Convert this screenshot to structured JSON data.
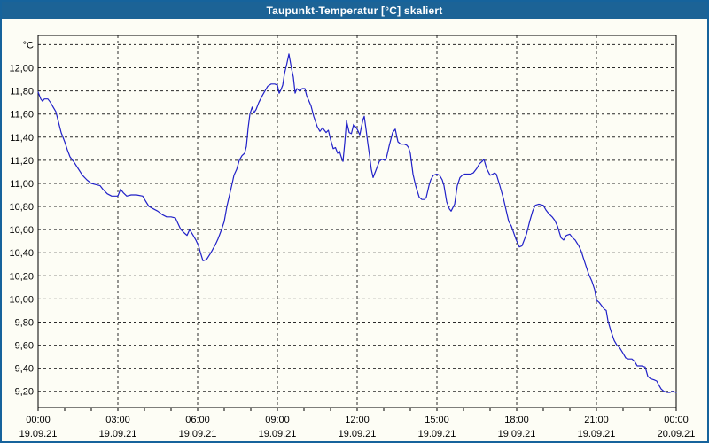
{
  "window": {
    "title": "Taupunkt-Temperatur [°C] skaliert"
  },
  "colors": {
    "titlebar_bg": "#1c6396",
    "titlebar_text": "#ffffff",
    "window_border": "#16639c",
    "window_bg": "#fdfdf5",
    "grid": "#2a2a2a",
    "axis": "#000000",
    "line": "#2121c8"
  },
  "chart_data": {
    "type": "line",
    "title": "Taupunkt-Temperatur [°C] skaliert",
    "ylabel_unit": "°C",
    "x_unit": "minutes since 00:00 19.09.21",
    "xlim": [
      0,
      1440
    ],
    "ylim": [
      9.06,
      12.28
    ],
    "grid": true,
    "legend": "none",
    "y_ticks": {
      "values": [
        9.2,
        9.4,
        9.6,
        9.8,
        10.0,
        10.2,
        10.4,
        10.6,
        10.8,
        11.0,
        11.2,
        11.4,
        11.6,
        11.8,
        12.0,
        12.2
      ],
      "labels": [
        "9,20",
        "9,40",
        "9,60",
        "9,80",
        "10,00",
        "10,20",
        "10,40",
        "10,60",
        "10,80",
        "11,00",
        "11,20",
        "11,40",
        "11,60",
        "11,80",
        "12,00",
        ""
      ]
    },
    "x_major_ticks": [
      {
        "minutes": 0,
        "time": "00:00",
        "date": "19.09.21"
      },
      {
        "minutes": 180,
        "time": "03:00",
        "date": "19.09.21"
      },
      {
        "minutes": 360,
        "time": "06:00",
        "date": "19.09.21"
      },
      {
        "minutes": 540,
        "time": "09:00",
        "date": "19.09.21"
      },
      {
        "minutes": 720,
        "time": "12:00",
        "date": "19.09.21"
      },
      {
        "minutes": 900,
        "time": "15:00",
        "date": "19.09.21"
      },
      {
        "minutes": 1080,
        "time": "18:00",
        "date": "19.09.21"
      },
      {
        "minutes": 1260,
        "time": "21:00",
        "date": "19.09.21"
      },
      {
        "minutes": 1440,
        "time": "00:00",
        "date": "20.09.21"
      }
    ],
    "x_minor_tick_minutes": 60,
    "series": [
      {
        "name": "Taupunkt-Temperatur",
        "color": "#2121c8",
        "points": [
          [
            0,
            11.79
          ],
          [
            6,
            11.73
          ],
          [
            10,
            11.71
          ],
          [
            14,
            11.73
          ],
          [
            22,
            11.73
          ],
          [
            28,
            11.7
          ],
          [
            34,
            11.66
          ],
          [
            40,
            11.62
          ],
          [
            46,
            11.53
          ],
          [
            52,
            11.44
          ],
          [
            60,
            11.36
          ],
          [
            66,
            11.29
          ],
          [
            72,
            11.23
          ],
          [
            80,
            11.19
          ],
          [
            90,
            11.13
          ],
          [
            100,
            11.07
          ],
          [
            110,
            11.03
          ],
          [
            120,
            11.0
          ],
          [
            130,
            10.99
          ],
          [
            140,
            10.98
          ],
          [
            146,
            10.95
          ],
          [
            156,
            10.91
          ],
          [
            166,
            10.89
          ],
          [
            180,
            10.89
          ],
          [
            186,
            10.95
          ],
          [
            192,
            10.92
          ],
          [
            200,
            10.89
          ],
          [
            210,
            10.9
          ],
          [
            222,
            10.9
          ],
          [
            236,
            10.89
          ],
          [
            242,
            10.85
          ],
          [
            250,
            10.8
          ],
          [
            260,
            10.78
          ],
          [
            270,
            10.76
          ],
          [
            280,
            10.73
          ],
          [
            290,
            10.71
          ],
          [
            300,
            10.71
          ],
          [
            310,
            10.7
          ],
          [
            316,
            10.65
          ],
          [
            322,
            10.6
          ],
          [
            330,
            10.57
          ],
          [
            336,
            10.55
          ],
          [
            342,
            10.6
          ],
          [
            350,
            10.55
          ],
          [
            356,
            10.51
          ],
          [
            362,
            10.46
          ],
          [
            368,
            10.38
          ],
          [
            372,
            10.33
          ],
          [
            380,
            10.34
          ],
          [
            390,
            10.4
          ],
          [
            400,
            10.47
          ],
          [
            406,
            10.52
          ],
          [
            414,
            10.6
          ],
          [
            420,
            10.67
          ],
          [
            426,
            10.8
          ],
          [
            432,
            10.9
          ],
          [
            438,
            11.0
          ],
          [
            442,
            11.07
          ],
          [
            448,
            11.12
          ],
          [
            454,
            11.2
          ],
          [
            460,
            11.24
          ],
          [
            466,
            11.26
          ],
          [
            470,
            11.32
          ],
          [
            474,
            11.48
          ],
          [
            478,
            11.6
          ],
          [
            483,
            11.66
          ],
          [
            487,
            11.61
          ],
          [
            492,
            11.64
          ],
          [
            498,
            11.7
          ],
          [
            506,
            11.76
          ],
          [
            512,
            11.8
          ],
          [
            518,
            11.84
          ],
          [
            526,
            11.86
          ],
          [
            534,
            11.86
          ],
          [
            540,
            11.85
          ],
          [
            544,
            11.78
          ],
          [
            548,
            11.81
          ],
          [
            552,
            11.85
          ],
          [
            556,
            11.95
          ],
          [
            561,
            12.03
          ],
          [
            566,
            12.12
          ],
          [
            572,
            11.99
          ],
          [
            576,
            11.92
          ],
          [
            580,
            11.78
          ],
          [
            584,
            11.82
          ],
          [
            590,
            11.8
          ],
          [
            596,
            11.82
          ],
          [
            602,
            11.82
          ],
          [
            606,
            11.76
          ],
          [
            616,
            11.67
          ],
          [
            622,
            11.58
          ],
          [
            630,
            11.49
          ],
          [
            636,
            11.45
          ],
          [
            642,
            11.48
          ],
          [
            650,
            11.44
          ],
          [
            655,
            11.46
          ],
          [
            660,
            11.38
          ],
          [
            666,
            11.3
          ],
          [
            671,
            11.31
          ],
          [
            676,
            11.26
          ],
          [
            680,
            11.28
          ],
          [
            684,
            11.23
          ],
          [
            688,
            11.19
          ],
          [
            692,
            11.35
          ],
          [
            696,
            11.54
          ],
          [
            702,
            11.44
          ],
          [
            707,
            11.43
          ],
          [
            712,
            11.51
          ],
          [
            720,
            11.47
          ],
          [
            726,
            11.42
          ],
          [
            733,
            11.55
          ],
          [
            736,
            11.58
          ],
          [
            740,
            11.47
          ],
          [
            744,
            11.35
          ],
          [
            748,
            11.24
          ],
          [
            752,
            11.12
          ],
          [
            756,
            11.05
          ],
          [
            762,
            11.11
          ],
          [
            770,
            11.19
          ],
          [
            776,
            11.21
          ],
          [
            782,
            11.2
          ],
          [
            786,
            11.22
          ],
          [
            792,
            11.32
          ],
          [
            800,
            11.44
          ],
          [
            806,
            11.47
          ],
          [
            812,
            11.36
          ],
          [
            818,
            11.34
          ],
          [
            826,
            11.34
          ],
          [
            832,
            11.33
          ],
          [
            836,
            11.31
          ],
          [
            840,
            11.26
          ],
          [
            846,
            11.08
          ],
          [
            852,
            10.98
          ],
          [
            860,
            10.88
          ],
          [
            866,
            10.86
          ],
          [
            872,
            10.86
          ],
          [
            876,
            10.88
          ],
          [
            882,
            10.98
          ],
          [
            886,
            11.03
          ],
          [
            892,
            11.07
          ],
          [
            900,
            11.08
          ],
          [
            906,
            11.07
          ],
          [
            912,
            11.03
          ],
          [
            916,
            10.98
          ],
          [
            922,
            10.84
          ],
          [
            928,
            10.78
          ],
          [
            932,
            10.76
          ],
          [
            940,
            10.82
          ],
          [
            946,
            10.98
          ],
          [
            952,
            11.05
          ],
          [
            960,
            11.08
          ],
          [
            968,
            11.08
          ],
          [
            976,
            11.08
          ],
          [
            982,
            11.09
          ],
          [
            990,
            11.13
          ],
          [
            996,
            11.17
          ],
          [
            1002,
            11.19
          ],
          [
            1006,
            11.21
          ],
          [
            1012,
            11.13
          ],
          [
            1020,
            11.07
          ],
          [
            1026,
            11.08
          ],
          [
            1030,
            11.09
          ],
          [
            1034,
            11.08
          ],
          [
            1042,
            10.98
          ],
          [
            1050,
            10.87
          ],
          [
            1056,
            10.77
          ],
          [
            1062,
            10.67
          ],
          [
            1068,
            10.63
          ],
          [
            1078,
            10.52
          ],
          [
            1086,
            10.45
          ],
          [
            1092,
            10.46
          ],
          [
            1102,
            10.56
          ],
          [
            1110,
            10.68
          ],
          [
            1116,
            10.76
          ],
          [
            1122,
            10.81
          ],
          [
            1130,
            10.82
          ],
          [
            1140,
            10.81
          ],
          [
            1146,
            10.77
          ],
          [
            1152,
            10.74
          ],
          [
            1160,
            10.71
          ],
          [
            1166,
            10.68
          ],
          [
            1172,
            10.63
          ],
          [
            1180,
            10.53
          ],
          [
            1186,
            10.51
          ],
          [
            1192,
            10.55
          ],
          [
            1200,
            10.56
          ],
          [
            1206,
            10.53
          ],
          [
            1212,
            10.51
          ],
          [
            1220,
            10.46
          ],
          [
            1226,
            10.41
          ],
          [
            1230,
            10.36
          ],
          [
            1236,
            10.29
          ],
          [
            1242,
            10.22
          ],
          [
            1250,
            10.15
          ],
          [
            1256,
            10.08
          ],
          [
            1260,
            9.99
          ],
          [
            1266,
            9.97
          ],
          [
            1274,
            9.93
          ],
          [
            1278,
            9.91
          ],
          [
            1282,
            9.9
          ],
          [
            1286,
            9.81
          ],
          [
            1292,
            9.73
          ],
          [
            1300,
            9.64
          ],
          [
            1306,
            9.6
          ],
          [
            1312,
            9.58
          ],
          [
            1320,
            9.53
          ],
          [
            1326,
            9.49
          ],
          [
            1332,
            9.48
          ],
          [
            1340,
            9.48
          ],
          [
            1346,
            9.46
          ],
          [
            1352,
            9.42
          ],
          [
            1362,
            9.42
          ],
          [
            1370,
            9.41
          ],
          [
            1376,
            9.33
          ],
          [
            1382,
            9.31
          ],
          [
            1390,
            9.3
          ],
          [
            1396,
            9.29
          ],
          [
            1400,
            9.26
          ],
          [
            1406,
            9.22
          ],
          [
            1412,
            9.2
          ],
          [
            1420,
            9.19
          ],
          [
            1426,
            9.19
          ],
          [
            1432,
            9.2
          ],
          [
            1440,
            9.19
          ]
        ]
      }
    ]
  }
}
